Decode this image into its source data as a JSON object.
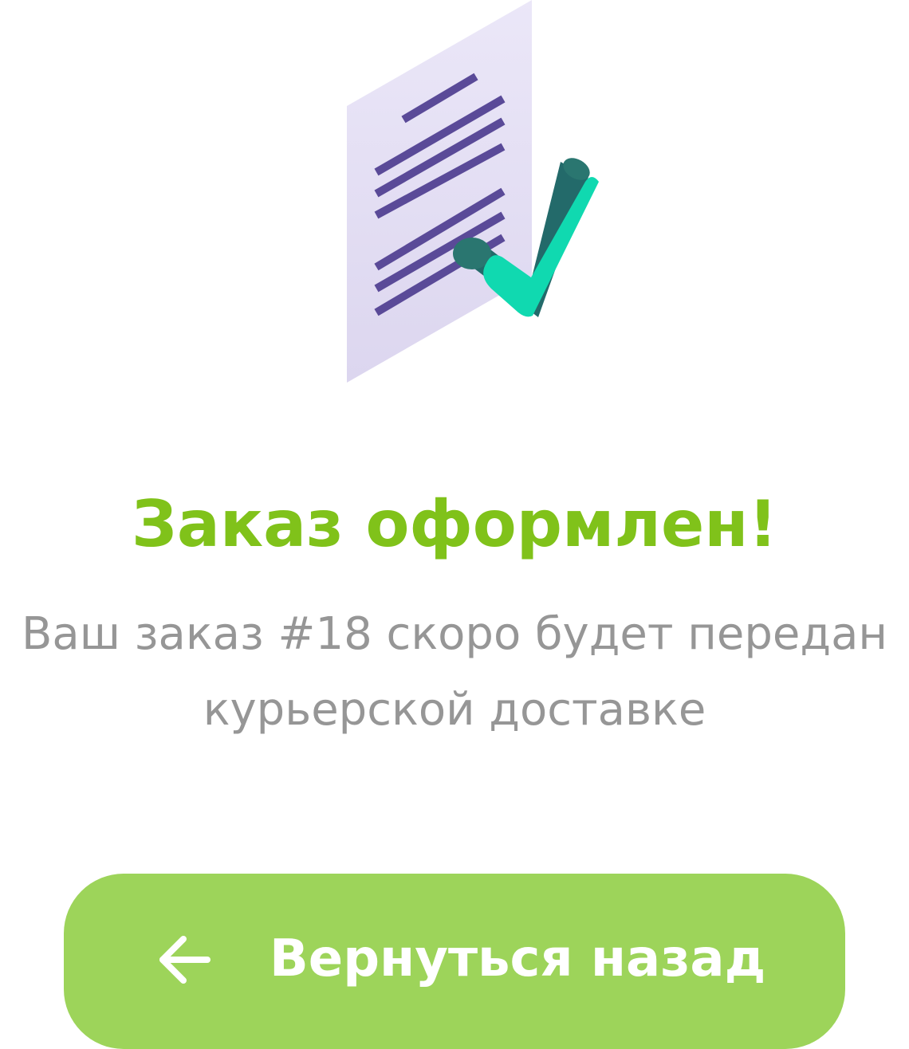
{
  "illustration": {
    "icon": "document-check-icon",
    "paper_color": "#e4e0f4",
    "lines_color": "#5a4a98",
    "check_color": "#10d9b0",
    "check_shadow_color": "#236a6a"
  },
  "confirmation": {
    "title": "Заказ оформлен!",
    "message_line1": "Ваш заказ #18 скоро будет передан",
    "message_line2": "курьерской доставке"
  },
  "back_button": {
    "label": "Вернуться назад",
    "icon": "arrow-left-icon"
  },
  "colors": {
    "title": "#80c21a",
    "message": "#969696",
    "button_background": "#9dd45a",
    "button_text": "#ffffff"
  }
}
